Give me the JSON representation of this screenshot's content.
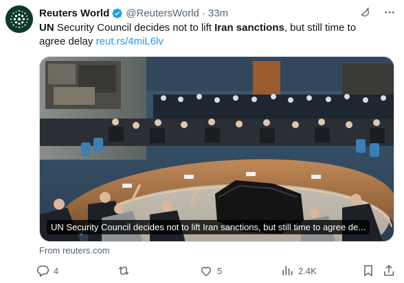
{
  "author": {
    "name": "Reuters World",
    "handle": "@ReutersWorld",
    "time": "33m",
    "separator": "·"
  },
  "tweet": {
    "bold_1": "UN",
    "text_1": " Security Council decides not to lift ",
    "bold_2": "Iran sanctions",
    "text_2": ", but still time to agree delay ",
    "link": "reut.rs/4miL6lv"
  },
  "card": {
    "caption": "UN Security Council decides not to lift Iran sanctions, but still time to agree de...",
    "source": "From reuters.com"
  },
  "actions": {
    "replies": "4",
    "reposts": "",
    "likes": "5",
    "views": "2.4K"
  },
  "icons": {
    "avatar": "reuters-logo",
    "verified": "verified-badge-icon",
    "grok": "grok-icon",
    "more": "more-icon",
    "reply": "reply-icon",
    "repost": "repost-icon",
    "like": "like-icon",
    "views": "views-icon",
    "bookmark": "bookmark-icon",
    "share": "share-icon"
  },
  "colors": {
    "link": "#1d9bf0",
    "verified": "#1d9bf0",
    "muted": "#536471",
    "text": "#0f1419"
  }
}
